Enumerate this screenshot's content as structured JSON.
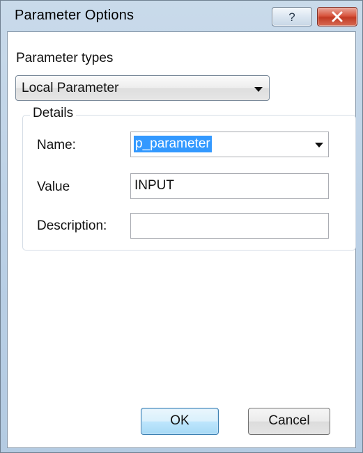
{
  "window": {
    "title": "Parameter Options",
    "help_glyph": "?",
    "close_icon": "close-icon",
    "help_icon": "help-icon"
  },
  "parameter_types": {
    "label": "Parameter types",
    "selected": "Local Parameter"
  },
  "details": {
    "group_title": "Details",
    "name_label": "Name:",
    "name_value": "p_parameter",
    "value_label": "Value",
    "value_value": "INPUT",
    "description_label": "Description:",
    "description_value": ""
  },
  "buttons": {
    "ok": "OK",
    "cancel": "Cancel"
  },
  "colors": {
    "selection": "#3399ff",
    "close_button": "#c94a33",
    "default_button_border": "#3c7fb1"
  }
}
